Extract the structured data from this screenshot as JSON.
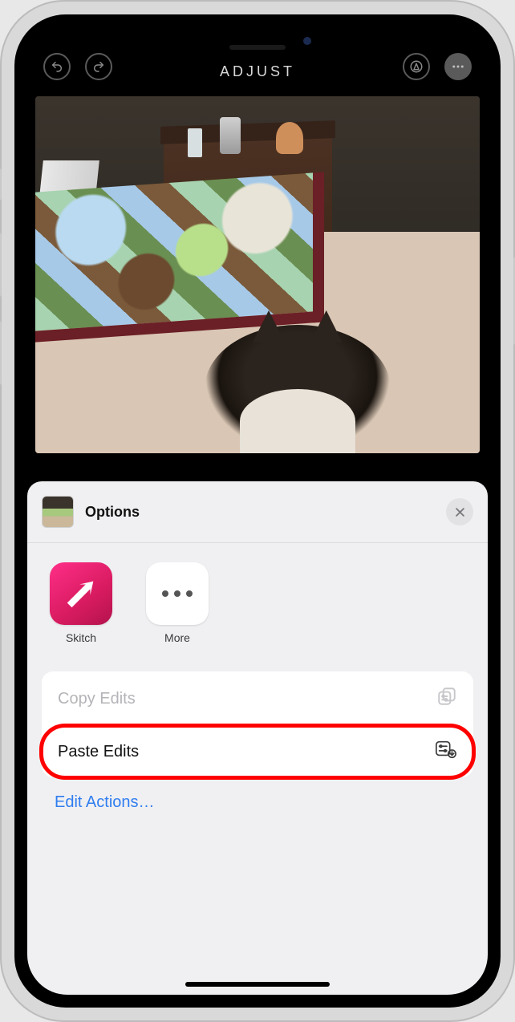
{
  "topbar": {
    "title": "ADJUST"
  },
  "sheet": {
    "title": "Options",
    "apps": [
      {
        "label": "Skitch"
      },
      {
        "label": "More"
      }
    ],
    "actions": {
      "copy": "Copy Edits",
      "paste": "Paste Edits"
    },
    "edit_actions": "Edit Actions…"
  }
}
